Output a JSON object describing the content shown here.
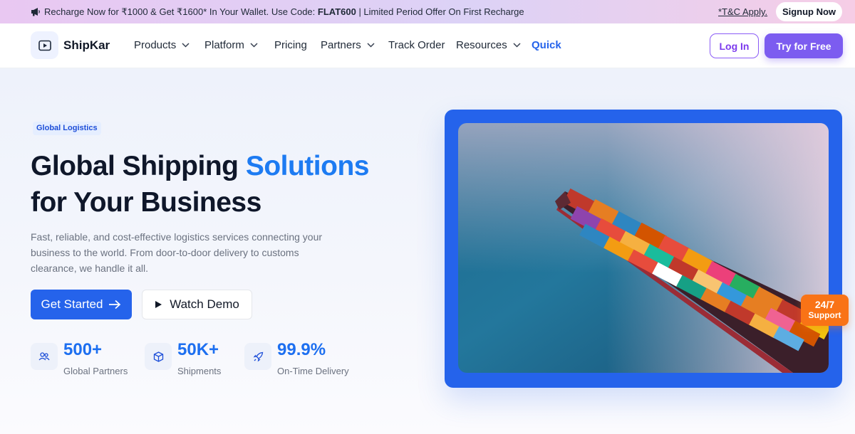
{
  "promo": {
    "text_before": "Recharge Now for ₹1000 & Get ₹1600* In Your Wallet. Use Code: ",
    "code": "FLAT600",
    "text_after": " | Limited Period Offer On First Recharge",
    "tc_label": "*T&C Apply.",
    "signup_label": "Signup Now",
    "icon": "megaphone-icon"
  },
  "brand": {
    "name": "ShipKar",
    "icon": "play-box-icon"
  },
  "nav": {
    "items": [
      {
        "label": "Products",
        "dropdown": true
      },
      {
        "label": "Platform",
        "dropdown": true
      },
      {
        "label": "Pricing",
        "dropdown": false
      },
      {
        "label": "Partners",
        "dropdown": true
      },
      {
        "label": "Track Order",
        "dropdown": false
      },
      {
        "label": "Resources",
        "dropdown": true
      },
      {
        "label": "Quick",
        "dropdown": false,
        "active": true
      }
    ],
    "login_label": "Log In",
    "try_label": "Try for Free"
  },
  "hero": {
    "badge": "Global Logistics",
    "title_part1": "Global Shipping ",
    "title_accent": "Solutions",
    "title_line2": "for Your Business",
    "description": "Fast, reliable, and cost-effective logistics services connecting your business to the world. From door-to-door delivery to customs clearance, we handle it all.",
    "primary_button": "Get Started",
    "primary_icon": "arrow-right-icon",
    "secondary_button": "Watch Demo",
    "secondary_icon": "play-icon"
  },
  "stats": [
    {
      "value": "500+",
      "label": "Global Partners",
      "icon": "users-icon"
    },
    {
      "value": "50K+",
      "label": "Shipments",
      "icon": "package-icon"
    },
    {
      "value": "99.9%",
      "label": "On-Time Delivery",
      "icon": "rocket-icon"
    }
  ],
  "support_badge": {
    "line1": "24/7",
    "line2": "Support"
  },
  "colors": {
    "primary": "#2563eb",
    "accent_text": "#1d7bf2",
    "purple": "#7c5cf0",
    "orange": "#f97316"
  }
}
